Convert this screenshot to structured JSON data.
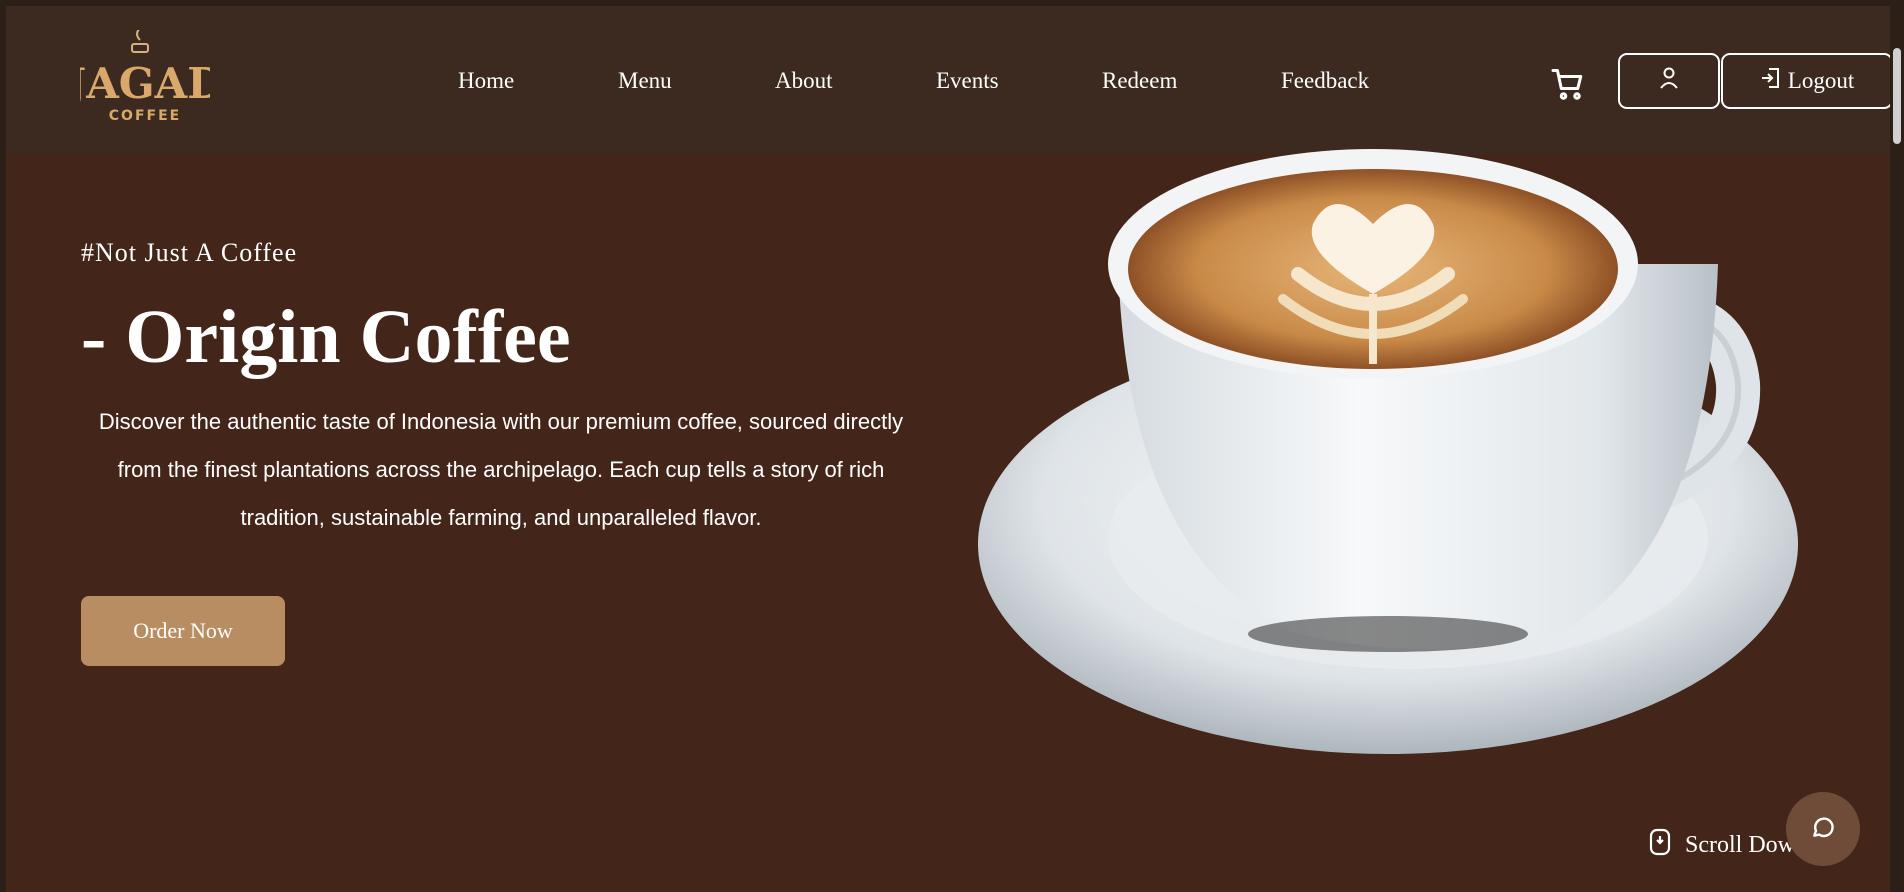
{
  "brand": {
    "name": "JAGAD",
    "sub": "COFFEE"
  },
  "nav": {
    "items": [
      {
        "label": "Home"
      },
      {
        "label": "Menu"
      },
      {
        "label": "About"
      },
      {
        "label": "Events"
      },
      {
        "label": "Redeem"
      },
      {
        "label": "Feedback"
      }
    ],
    "logout_label": "Logout"
  },
  "hero": {
    "tagline": "#Not Just A Coffee",
    "headline": "- Origin Coffee",
    "description": "Discover the authentic taste of Indonesia with our premium coffee, sourced directly from the finest plantations across the archipelago. Each cup tells a story of rich tradition, sustainable farming, and unparalleled flavor.",
    "cta_label": "Order Now"
  },
  "scroll": {
    "label": "Scroll Dow"
  },
  "colors": {
    "header_bg": "#3c2a20",
    "hero_bg": "#432619",
    "accent": "#b98d62",
    "chat_bg": "#6e4c37"
  },
  "icons": [
    "cart-icon",
    "user-icon",
    "logout-icon",
    "mouse-icon",
    "chat-icon"
  ]
}
